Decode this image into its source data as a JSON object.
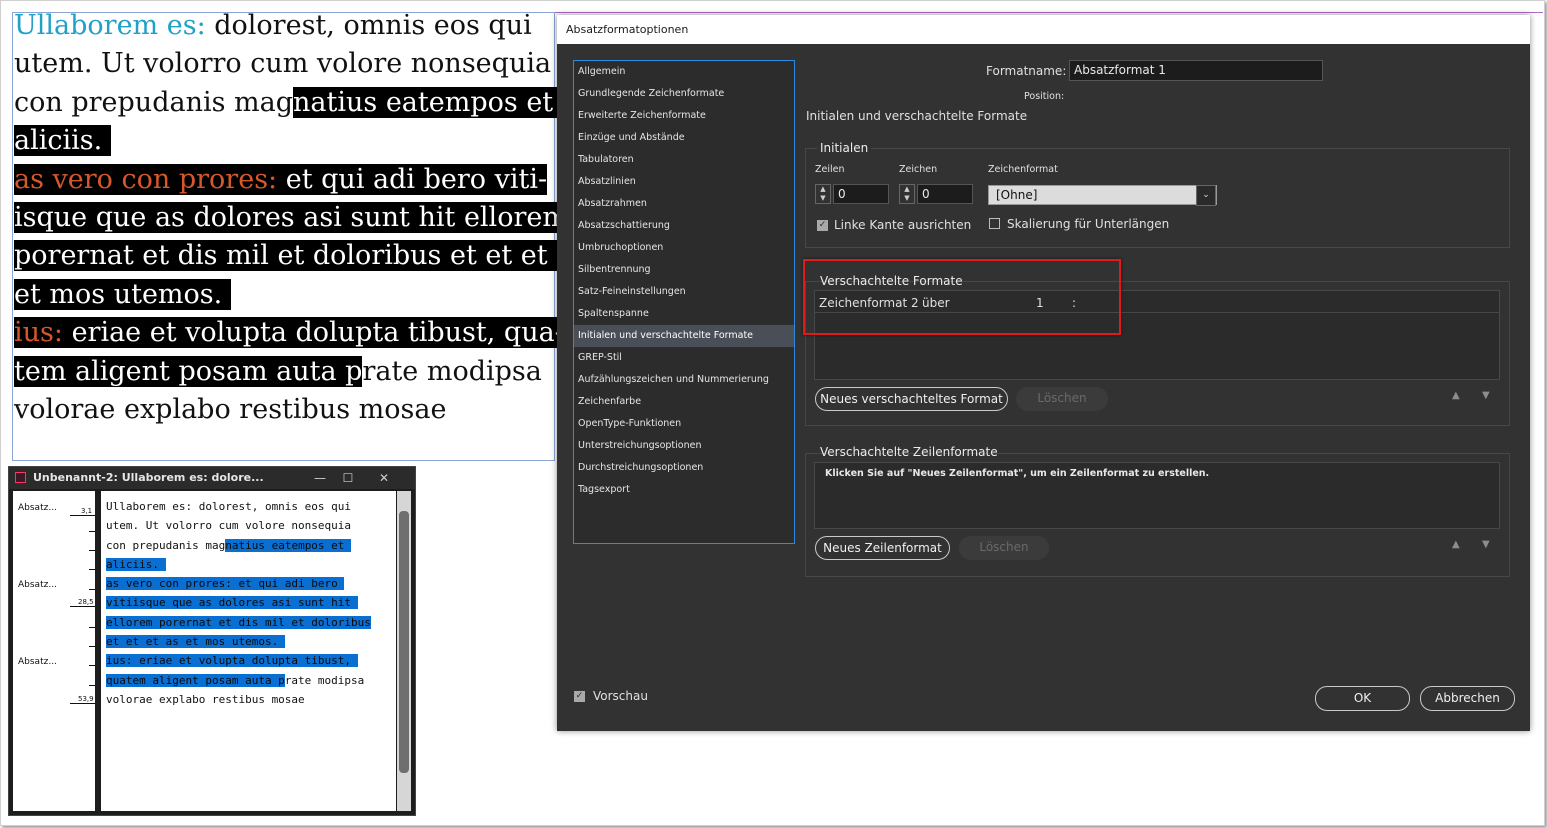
{
  "document": {
    "lines": [
      [
        {
          "t": "Ullaborem es:",
          "s": "blue"
        },
        {
          "t": " dolorest, omnis eos qui",
          "s": ""
        }
      ],
      [
        {
          "t": "utem. Ut volorro cum volore nonsequia",
          "s": ""
        }
      ],
      [
        {
          "t": "con prepudanis mag",
          "s": ""
        },
        {
          "t": "natius eatempos et ",
          "s": "hl"
        }
      ],
      [
        {
          "t": "aliciis. ",
          "s": "hl"
        }
      ],
      [
        {
          "t": "as vero con prores:",
          "s": "orange hl"
        },
        {
          "t": " et qui adi bero viti-",
          "s": "hl"
        }
      ],
      [
        {
          "t": "isque que as dolores asi sunt hit ellorem ",
          "s": "hl"
        }
      ],
      [
        {
          "t": "porernat et dis mil et doloribus et et et as ",
          "s": "hl"
        }
      ],
      [
        {
          "t": "et mos utemos. ",
          "s": "hl"
        }
      ],
      [
        {
          "t": "ius:",
          "s": "orange hl"
        },
        {
          "t": " eriae et volupta dolupta tibust, qua-",
          "s": "hl"
        }
      ],
      [
        {
          "t": "tem aligent posam auta p",
          "s": "hl"
        },
        {
          "t": "rate modipsa",
          "s": ""
        }
      ],
      [
        {
          "t": "volorae explabo restibus mosae",
          "s": ""
        }
      ]
    ]
  },
  "story_editor": {
    "title": "Unbenannt-2: Ullaborem es: dolore...",
    "minimize": "—",
    "maximize": "☐",
    "close": "✕",
    "para_labels": [
      "Absatz...",
      "Absatz...",
      "Absatz..."
    ],
    "depth_marks": [
      "3,1",
      "28,5",
      "53,9"
    ],
    "lines": [
      [
        {
          "t": "Ullaborem es: dolorest, omnis eos qui",
          "s": ""
        }
      ],
      [
        {
          "t": "utem. Ut volorro cum volore nonsequia",
          "s": ""
        }
      ],
      [
        {
          "t": "con prepudanis mag",
          "s": ""
        },
        {
          "t": "natius eatempos et ",
          "s": "shl"
        }
      ],
      [
        {
          "t": "aliciis. ",
          "s": "shl"
        }
      ],
      [
        {
          "t": "as vero con prores: et qui adi bero ",
          "s": "shl"
        }
      ],
      [
        {
          "t": "vitiisque que as dolores asi sunt hit ",
          "s": "shl"
        }
      ],
      [
        {
          "t": "ellorem porernat et dis mil et doloribus",
          "s": "shl"
        }
      ],
      [
        {
          "t": "et et et as et mos utemos. ",
          "s": "shl"
        }
      ],
      [
        {
          "t": "ius: eriae et volupta dolupta tibust, ",
          "s": "shl"
        }
      ],
      [
        {
          "t": "quatem aligent posam auta p",
          "s": "shl"
        },
        {
          "t": "rate modipsa",
          "s": ""
        }
      ],
      [
        {
          "t": "volorae explabo restibus mosae",
          "s": ""
        }
      ]
    ]
  },
  "dialog": {
    "title": "Absatzformatoptionen",
    "nav_items": [
      "Allgemein",
      "Grundlegende Zeichenformate",
      "Erweiterte Zeichenformate",
      "Einzüge und Abstände",
      "Tabulatoren",
      "Absatzlinien",
      "Absatzrahmen",
      "Absatzschattierung",
      "Umbruchoptionen",
      "Silbentrennung",
      "Satz-Feineinstellungen",
      "Spaltenspanne",
      "Initialen und verschachtelte Formate",
      "GREP-Stil",
      "Aufzählungszeichen und Nummerierung",
      "Zeichenfarbe",
      "OpenType-Funktionen",
      "Unterstreichungsoptionen",
      "Durchstreichungsoptionen",
      "Tagsexport"
    ],
    "selected_nav_index": 12,
    "formatname_label": "Formatname:",
    "formatname_value": "Absatzformat 1",
    "position_label": "Position:",
    "section_title": "Initialen und verschachtelte Formate",
    "initialen": {
      "title": "Initialen",
      "zeilen_label": "Zeilen",
      "zeilen_value": "0",
      "zeichen_label": "Zeichen",
      "zeichen_value": "0",
      "zeichenformat_label": "Zeichenformat",
      "zeichenformat_value": "[Ohne]",
      "linke_kante_label": "Linke Kante ausrichten",
      "linke_kante_checked": true,
      "skalierung_label": "Skalierung für Unterlängen",
      "skalierung_checked": false
    },
    "nested_styles": {
      "title": "Verschachtelte Formate",
      "row": {
        "style": "Zeichenformat 2",
        "mode": "über",
        "count": "1",
        "delim": ":"
      },
      "new_button": "Neues verschachteltes Format",
      "delete_button": "Löschen"
    },
    "nested_line_styles": {
      "title": "Verschachtelte Zeilenformate",
      "hint": "Klicken Sie auf \"Neues Zeilenformat\", um ein Zeilenformat zu erstellen.",
      "new_button": "Neues Zeilenformat",
      "delete_button": "Löschen"
    },
    "up_arrow": "▲",
    "down_arrow": "▼",
    "preview_label": "Vorschau",
    "preview_checked": true,
    "ok_button": "OK",
    "cancel_button": "Abbrechen"
  }
}
